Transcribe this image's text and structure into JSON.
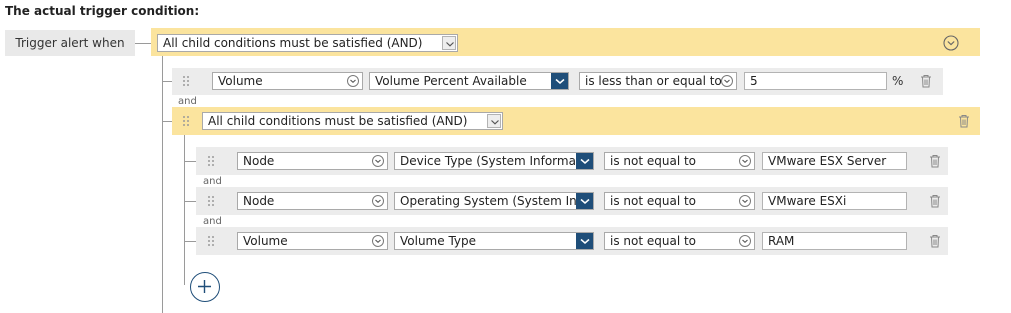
{
  "heading": "The actual trigger condition:",
  "trigger_label": "Trigger alert when",
  "top_group": {
    "logic": "All child conditions must be satisfied (AND)"
  },
  "and_label": "and",
  "row1": {
    "object": "Volume",
    "field": "Volume Percent Available",
    "operator": "is less than or equal to",
    "value": "5",
    "unit": "%"
  },
  "sub_group": {
    "logic": "All child conditions must be satisfied (AND)"
  },
  "sub_rows": [
    {
      "object": "Node",
      "field": "Device Type (System Information)",
      "operator": "is not equal to",
      "value": "VMware ESX Server"
    },
    {
      "object": "Node",
      "field": "Operating System (System Information)",
      "operator": "is not equal to",
      "value": "VMware ESXi"
    },
    {
      "object": "Volume",
      "field": "Volume Type",
      "operator": "is not equal to",
      "value": "RAM"
    }
  ],
  "icons": {
    "grip": "drag-handle-icon",
    "trash": "trash-icon",
    "chevron": "chevron-down-icon",
    "add": "plus-icon",
    "collapse": "collapse-icon"
  },
  "colors": {
    "group_band": "#fbe49e",
    "row_band": "#ececec",
    "accent": "#1f4e79"
  }
}
